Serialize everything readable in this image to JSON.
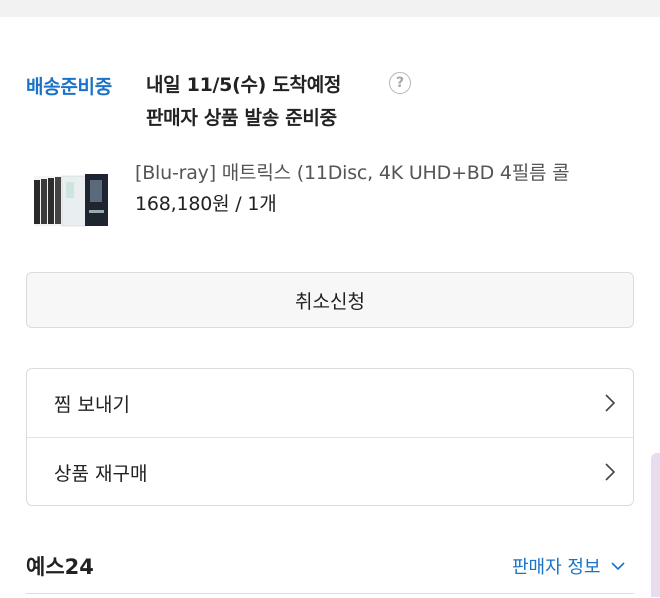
{
  "order": {
    "status_label": "배송준비중",
    "arrival": "내일 11/5(수) 도착예정",
    "seller_status": "판매자 상품 발송 준비중",
    "help_symbol": "?"
  },
  "product": {
    "title": "[Blu-ray] 매트릭스 (11Disc, 4K UHD+BD 4필름 콜",
    "price_qty": "168,180원 / 1개",
    "thumbnail_icon": "bluray-boxset-thumbnail"
  },
  "actions": {
    "cancel_label": "취소신청"
  },
  "menu": {
    "items": [
      {
        "label": "찜 보내기",
        "icon": "chevron-right-icon"
      },
      {
        "label": "상품 재구매",
        "icon": "chevron-right-icon"
      }
    ]
  },
  "seller": {
    "name": "예스24",
    "info_label": "판매자 정보",
    "info_icon": "chevron-down-icon"
  },
  "colors": {
    "accent": "#1a73c6",
    "button_bg": "#f7f7f7",
    "border": "#dcdcdc"
  }
}
